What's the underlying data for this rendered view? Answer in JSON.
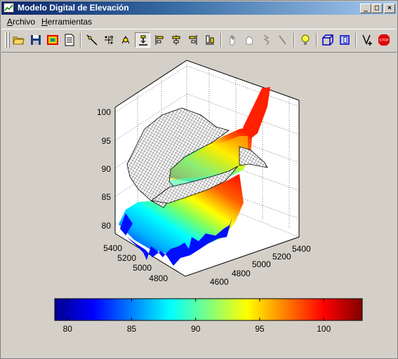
{
  "window": {
    "title": "Modelo Digital de Elevación"
  },
  "window_buttons": {
    "minimize": "_",
    "maximize": "□",
    "close": "×"
  },
  "menu": [
    {
      "label": "Archivo",
      "accel": "A",
      "rest": "rchivo"
    },
    {
      "label": "Herramientas",
      "accel": "H",
      "rest": "erramientas"
    }
  ],
  "toolbar": [
    {
      "name": "open-folder-icon"
    },
    {
      "name": "save-disk-icon"
    },
    {
      "name": "color-image-icon"
    },
    {
      "name": "document-icon"
    },
    {
      "name": "zoom-line-icon"
    },
    {
      "name": "scatter-points-icon"
    },
    {
      "name": "rotate-icon"
    },
    {
      "name": "select-tool-icon",
      "pressed": true
    },
    {
      "name": "align-left-icon"
    },
    {
      "name": "align-center-icon"
    },
    {
      "name": "align-right-icon"
    },
    {
      "name": "distribute-icon"
    },
    {
      "name": "hand-icon"
    },
    {
      "name": "hand-grab-icon"
    },
    {
      "name": "arrow-lightning-icon"
    },
    {
      "name": "pen-icon"
    },
    {
      "name": "light-bulb-icon"
    },
    {
      "name": "cube-view-icon"
    },
    {
      "name": "box-view-icon"
    },
    {
      "name": "add-vertex-icon"
    },
    {
      "name": "stop-icon",
      "stop_label": "STOP"
    }
  ],
  "chart_data": {
    "type": "surface",
    "title": "",
    "z_ticks": [
      "80",
      "85",
      "90",
      "95",
      "100"
    ],
    "x_ticks": [
      "4600",
      "4800",
      "5000",
      "5200",
      "5400"
    ],
    "y_ticks": [
      "4800",
      "5000",
      "5200",
      "5400"
    ],
    "zlim": [
      79,
      103
    ],
    "grid": true,
    "colorbar": {
      "colormap": "jet",
      "range": [
        79,
        103
      ],
      "ticks": [
        "80",
        "85",
        "90",
        "95",
        "100"
      ]
    }
  }
}
